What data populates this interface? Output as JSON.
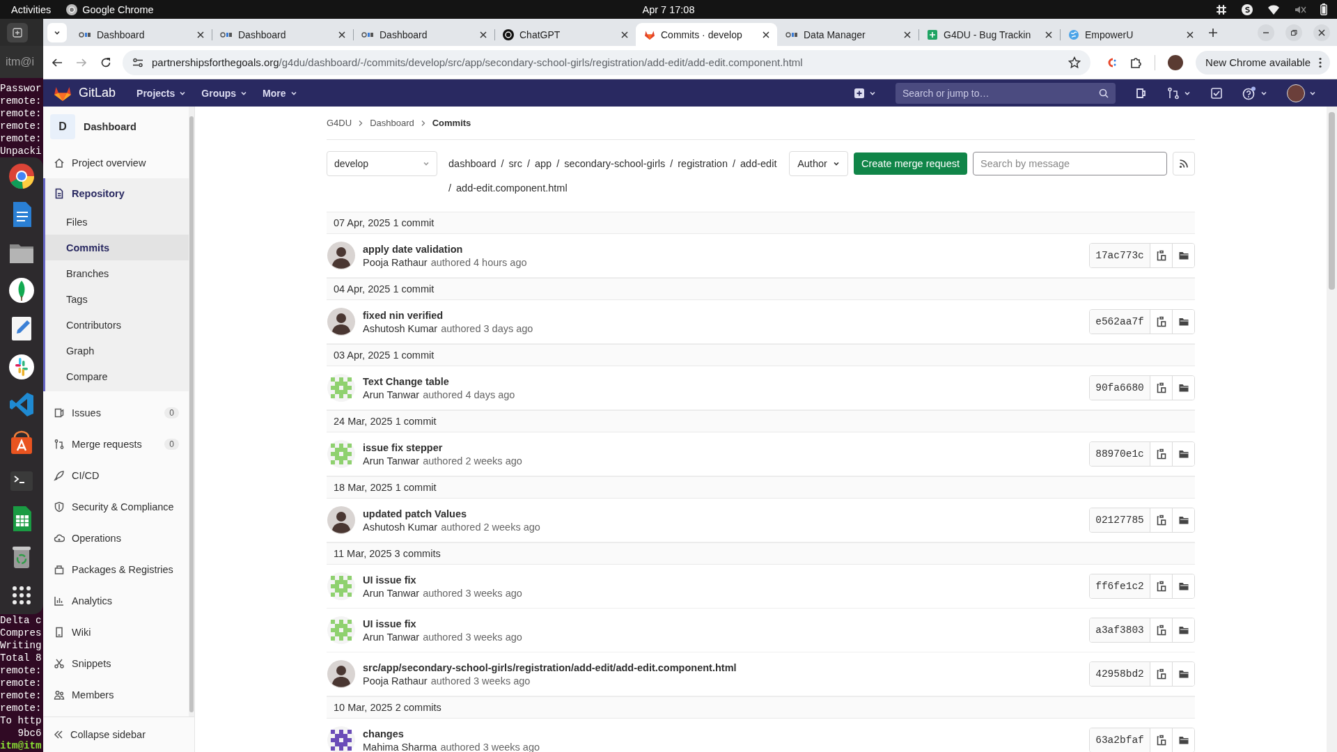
{
  "system_bar": {
    "activities": "Activities",
    "app_name": "Google Chrome",
    "clock": "Apr 7  17:08"
  },
  "terminal": {
    "title": "itm@i",
    "lines_above_dock": [
      {
        "text": "Passwor",
        "kind": "output"
      },
      {
        "text": "remote:",
        "kind": "output"
      },
      {
        "text": "remote:",
        "kind": "output"
      },
      {
        "text": "remote:",
        "kind": "output"
      },
      {
        "text": "remote:",
        "kind": "output"
      },
      {
        "text": "Unpacki",
        "kind": "output"
      }
    ],
    "lines_below_dock": [
      {
        "text": "Delta c",
        "kind": "output"
      },
      {
        "text": "Compres",
        "kind": "output"
      },
      {
        "text": "Writing",
        "kind": "output"
      },
      {
        "text": "Total 8",
        "kind": "output"
      },
      {
        "text": "remote:",
        "kind": "output"
      },
      {
        "text": "remote:",
        "kind": "output"
      },
      {
        "text": "remote:",
        "kind": "output"
      },
      {
        "text": "remote:",
        "kind": "output"
      },
      {
        "text": "To http",
        "kind": "output"
      },
      {
        "text": "   9bc6",
        "kind": "output"
      },
      {
        "text": "itm@itm",
        "kind": "prompt"
      }
    ]
  },
  "browser": {
    "tabs": [
      {
        "title": "Dashboard",
        "selected": false
      },
      {
        "title": "Dashboard",
        "selected": false
      },
      {
        "title": "Dashboard",
        "selected": false
      },
      {
        "title": "ChatGPT",
        "selected": false
      },
      {
        "title": "Commits · develop",
        "selected": true
      },
      {
        "title": "Data Manager",
        "selected": false
      },
      {
        "title": "G4DU - Bug Trackin",
        "selected": false
      },
      {
        "title": "EmpowerU",
        "selected": false
      }
    ],
    "url": {
      "host": "partnershipsforthegoals.org",
      "path": "/g4du/dashboard/-/commits/develop/src/app/secondary-school-girls/registration/add-edit/add-edit.component.html"
    },
    "update_button": "New Chrome available"
  },
  "gitlab_header": {
    "brand": "GitLab",
    "nav": [
      "Projects",
      "Groups",
      "More"
    ],
    "search": {
      "placeholder": "Search or jump to…"
    }
  },
  "sidebar": {
    "project": {
      "initial": "D",
      "name": "Dashboard"
    },
    "items": [
      {
        "label": "Project overview",
        "selected": false
      },
      {
        "label": "Repository",
        "selected": true,
        "expanded": true,
        "children": [
          {
            "label": "Files",
            "selected": false
          },
          {
            "label": "Commits",
            "selected": true
          },
          {
            "label": "Branches",
            "selected": false
          },
          {
            "label": "Tags",
            "selected": false
          },
          {
            "label": "Contributors",
            "selected": false
          },
          {
            "label": "Graph",
            "selected": false
          },
          {
            "label": "Compare",
            "selected": false
          }
        ]
      },
      {
        "label": "Issues",
        "selected": false,
        "count": "0"
      },
      {
        "label": "Merge requests",
        "selected": false,
        "count": "0"
      },
      {
        "label": "CI/CD",
        "selected": false
      },
      {
        "label": "Security & Compliance",
        "selected": false
      },
      {
        "label": "Operations",
        "selected": false
      },
      {
        "label": "Packages & Registries",
        "selected": false
      },
      {
        "label": "Analytics",
        "selected": false
      },
      {
        "label": "Wiki",
        "selected": false
      },
      {
        "label": "Snippets",
        "selected": false
      },
      {
        "label": "Members",
        "selected": false
      }
    ],
    "collapse": "Collapse sidebar"
  },
  "breadcrumbs": [
    "G4DU",
    "Dashboard",
    "Commits"
  ],
  "filters": {
    "branch": "develop",
    "path_separator": "/",
    "path": [
      "dashboard",
      "src",
      "app",
      "secondary-school-girls",
      "registration",
      "add-edit",
      "add-edit.component.html"
    ],
    "author": "Author",
    "create_button": "Create merge request",
    "search": {
      "placeholder": "Search by message"
    }
  },
  "commit_groups": [
    {
      "heading": "07 Apr, 2025 1 commit",
      "commits": [
        {
          "title": "apply date validation",
          "author": "Pooja Rathaur",
          "time": "authored 4 hours ago",
          "sha": "17ac773c",
          "avatar": {
            "kind": "photo"
          }
        }
      ]
    },
    {
      "heading": "04 Apr, 2025 1 commit",
      "commits": [
        {
          "title": "fixed nin verified",
          "author": "Ashutosh Kumar",
          "time": "authored 3 days ago",
          "sha": "e562aa7f",
          "avatar": {
            "kind": "photo"
          }
        }
      ]
    },
    {
      "heading": "03 Apr, 2025 1 commit",
      "commits": [
        {
          "title": "Text Change table",
          "author": "Arun Tanwar",
          "time": "authored 4 days ago",
          "sha": "90fa6680",
          "avatar": {
            "kind": "identicon",
            "color": "#8fd16f"
          }
        }
      ]
    },
    {
      "heading": "24 Mar, 2025 1 commit",
      "commits": [
        {
          "title": "issue fix stepper",
          "author": "Arun Tanwar",
          "time": "authored 2 weeks ago",
          "sha": "88970e1c",
          "avatar": {
            "kind": "identicon",
            "color": "#8fd16f"
          }
        }
      ]
    },
    {
      "heading": "18 Mar, 2025 1 commit",
      "commits": [
        {
          "title": "updated patch Values",
          "author": "Ashutosh Kumar",
          "time": "authored 2 weeks ago",
          "sha": "02127785",
          "avatar": {
            "kind": "photo"
          }
        }
      ]
    },
    {
      "heading": "11 Mar, 2025 3 commits",
      "commits": [
        {
          "title": "UI issue fix",
          "author": "Arun Tanwar",
          "time": "authored 3 weeks ago",
          "sha": "ff6fe1c2",
          "avatar": {
            "kind": "identicon",
            "color": "#8fd16f"
          }
        },
        {
          "title": "UI issue fix",
          "author": "Arun Tanwar",
          "time": "authored 3 weeks ago",
          "sha": "a3af3803",
          "avatar": {
            "kind": "identicon",
            "color": "#8fd16f"
          }
        },
        {
          "title": "src/app/secondary-school-girls/registration/add-edit/add-edit.component.html",
          "author": "Pooja Rathaur",
          "time": "authored 3 weeks ago",
          "sha": "42958bd2",
          "avatar": {
            "kind": "photo"
          }
        }
      ]
    },
    {
      "heading": "10 Mar, 2025 2 commits",
      "commits": [
        {
          "title": "changes",
          "author": "Mahima Sharma",
          "time": "authored 3 weeks ago",
          "sha": "63a2bfaf",
          "avatar": {
            "kind": "identicon",
            "color": "#6a4cb8"
          }
        }
      ]
    }
  ]
}
